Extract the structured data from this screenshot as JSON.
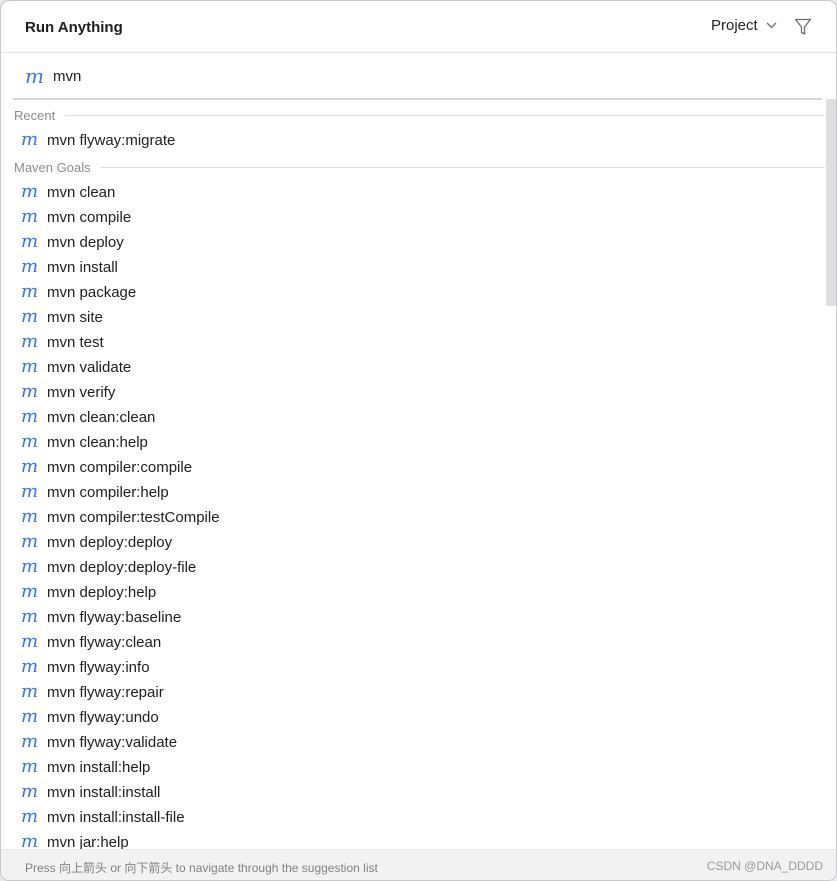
{
  "window": {
    "title": "Run Anything",
    "scope_label": "Project"
  },
  "search": {
    "icon_glyph": "m",
    "value": "mvn"
  },
  "sections": [
    {
      "label": "Recent",
      "items": [
        "mvn flyway:migrate"
      ]
    },
    {
      "label": "Maven Goals",
      "items": [
        "mvn clean",
        "mvn compile",
        "mvn deploy",
        "mvn install",
        "mvn package",
        "mvn site",
        "mvn test",
        "mvn validate",
        "mvn verify",
        "mvn clean:clean",
        "mvn clean:help",
        "mvn compiler:compile",
        "mvn compiler:help",
        "mvn compiler:testCompile",
        "mvn deploy:deploy",
        "mvn deploy:deploy-file",
        "mvn deploy:help",
        "mvn flyway:baseline",
        "mvn flyway:clean",
        "mvn flyway:info",
        "mvn flyway:repair",
        "mvn flyway:undo",
        "mvn flyway:validate",
        "mvn install:help",
        "mvn install:install",
        "mvn install:install-file",
        "mvn jar:help"
      ]
    }
  ],
  "footer": {
    "hint": "Press 向上箭头 or 向下箭头 to navigate through the suggestion list",
    "watermark": "CSDN @DNA_DDDD"
  },
  "icons": {
    "maven": "maven-m-icon",
    "scope_dropdown": "chevron-down-icon",
    "filter": "filter-icon"
  },
  "colors": {
    "accent": "#3574f0",
    "text": "#1e1e1e",
    "muted": "#8c8c8c",
    "footer_bg": "#f2f2f3"
  }
}
